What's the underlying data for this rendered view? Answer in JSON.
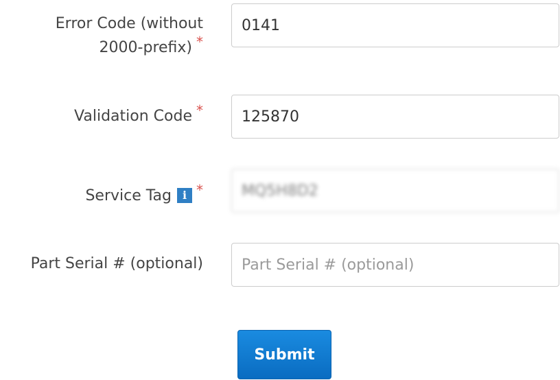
{
  "form": {
    "error_code": {
      "label_line1": "Error Code (without",
      "label_line2": "2000-prefix)",
      "required_mark": "*",
      "value": "0141"
    },
    "validation_code": {
      "label": "Validation Code",
      "required_mark": "*",
      "value": "125870"
    },
    "service_tag": {
      "label": "Service Tag",
      "info_icon_glyph": "i",
      "required_mark": "*",
      "value": "MQ5H8D2"
    },
    "part_serial": {
      "label": "Part Serial # (optional)",
      "placeholder": "Part Serial # (optional)",
      "value": ""
    },
    "submit_label": "Submit"
  },
  "colors": {
    "required": "#d9534f",
    "info_icon": "#2f7fc4",
    "button": "#0a6cc1"
  },
  "icons": [
    "info-icon"
  ]
}
